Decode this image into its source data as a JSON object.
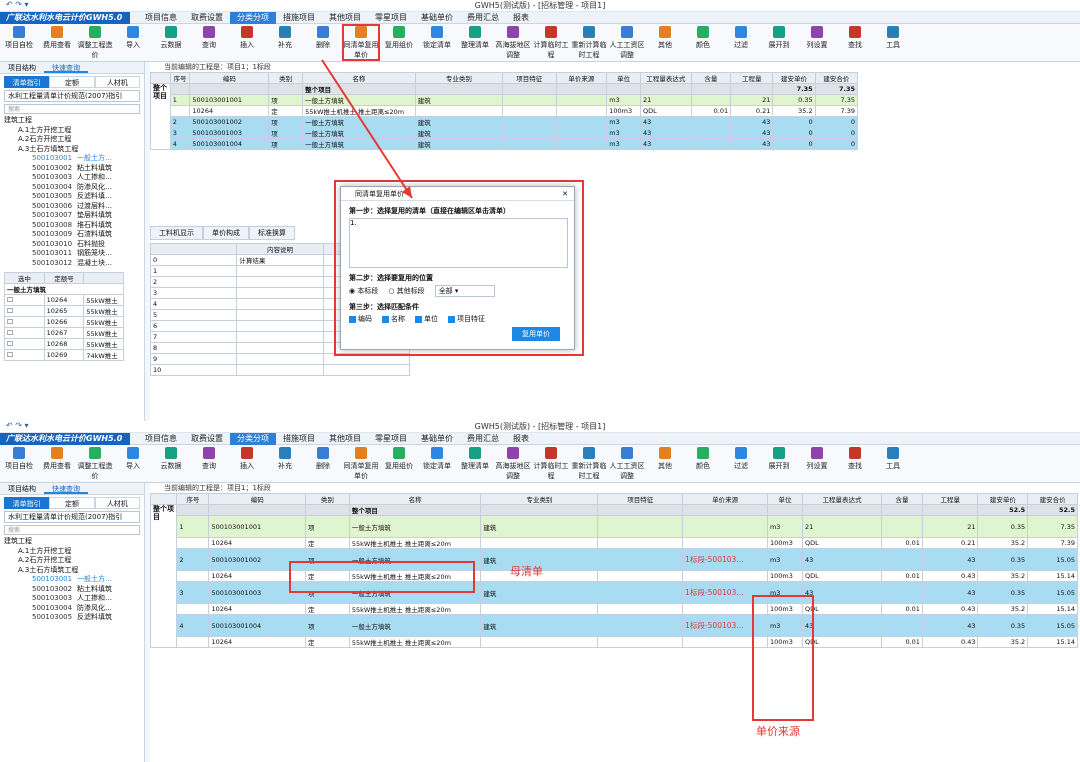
{
  "top": {
    "title": "GWH5(测试版) - [招标管理 - 项目1]",
    "brand": "广联达水利水电云计价GWH5.0",
    "menus": [
      "项目信息",
      "取费设置",
      "分类分项",
      "措施项目",
      "其他项目",
      "零星项目",
      "基础单价",
      "费用汇总",
      "报表"
    ],
    "active_menu": "分类分项",
    "ribbon": [
      "项目自检",
      "费用查看",
      "调整工程造价",
      "导入",
      "云数据",
      "查询",
      "插入",
      "补充",
      "删除",
      "同清单复用单价",
      "复用组价",
      "锁定清单",
      "整理清单",
      "高海拔地区调整",
      "计算临时工程",
      "重新计算临时工程",
      "人工工资区调整",
      "其他",
      "颜色",
      "过滤",
      "展开到",
      "列设置",
      "查找",
      "工具"
    ],
    "left_tabs": [
      "项目结构",
      "快速查询"
    ],
    "left_sub": [
      "清单指引",
      "定额",
      "人材机"
    ],
    "spec": "水利工程量清单计价规范(2007)指引",
    "search_placeholder": "搜索",
    "tree": [
      {
        "t": "建筑工程"
      },
      {
        "t": "A.1土方开挖工程"
      },
      {
        "t": "A.2石方开挖工程"
      },
      {
        "t": "A.3土石方填筑工程"
      },
      {
        "c": "500103001",
        "t": "一般土方…"
      },
      {
        "c": "500103002",
        "t": "粘土料填筑"
      },
      {
        "c": "500103003",
        "t": "人工掺和…"
      },
      {
        "c": "500103004",
        "t": "防渗风化…"
      },
      {
        "c": "500103005",
        "t": "反滤料填…"
      },
      {
        "c": "500103006",
        "t": "过渡层料…"
      },
      {
        "c": "500103007",
        "t": "垫层料填筑"
      },
      {
        "c": "500103008",
        "t": "堆石料填筑"
      },
      {
        "c": "500103009",
        "t": "石渣料填筑"
      },
      {
        "c": "500103010",
        "t": "石料抛投"
      },
      {
        "c": "500103011",
        "t": "钢筋笼块…"
      },
      {
        "c": "500103012",
        "t": "混凝土块…"
      }
    ],
    "sel_header": [
      "选中",
      "定额号"
    ],
    "sel_group": "一般土方填筑",
    "sel_rows": [
      [
        "10264",
        "55kW推土"
      ],
      [
        "10265",
        "55kW推土"
      ],
      [
        "10266",
        "55kW推土"
      ],
      [
        "10267",
        "55kW推土"
      ],
      [
        "10268",
        "55kW推土"
      ],
      [
        "10269",
        "74kW推土"
      ]
    ],
    "path": "当前编辑的工程是：项目1；1标段",
    "columns": [
      "序号",
      "编码",
      "类别",
      "名称",
      "专业类别",
      "项目特征",
      "单价来源",
      "单位",
      "工程量表达式",
      "含量",
      "工程量",
      "建安单价",
      "建安合价"
    ],
    "total_row": {
      "name": "整个项目",
      "price": "7.35",
      "sum": "7.35"
    },
    "side_label": "整个项目",
    "rows": [
      {
        "no": "1",
        "code": "500103001001",
        "kind": "项",
        "name": "一般土方填筑",
        "pro": "建筑",
        "unit": "m3",
        "expr": "21",
        "qty": "21",
        "price": "0.35",
        "sum": "7.35",
        "style": "green"
      },
      {
        "no": "",
        "code": "10264",
        "kind": "定",
        "name": "55kW推土机推土 推土距离≤20m",
        "pro": "",
        "unit": "100m3",
        "expr": "QDL",
        "rate": "0.01",
        "qty": "0.21",
        "price": "35.2",
        "sum": "7.39",
        "style": "white"
      },
      {
        "no": "2",
        "code": "500103001002",
        "kind": "项",
        "name": "一般土方填筑",
        "pro": "建筑",
        "unit": "m3",
        "expr": "43",
        "qty": "43",
        "price": "0",
        "sum": "0",
        "style": "blue"
      },
      {
        "no": "3",
        "code": "500103001003",
        "kind": "项",
        "name": "一般土方填筑",
        "pro": "建筑",
        "unit": "m3",
        "expr": "43",
        "qty": "43",
        "price": "0",
        "sum": "0",
        "style": "blue"
      },
      {
        "no": "4",
        "code": "500103001004",
        "kind": "项",
        "name": "一般土方填筑",
        "pro": "建筑",
        "unit": "m3",
        "expr": "43",
        "qty": "43",
        "price": "0",
        "sum": "0",
        "style": "blue"
      }
    ],
    "bottom_tabs": [
      "工料机显示",
      "单价构成",
      "标准换算"
    ],
    "detail_head": "内容说明",
    "detail_first": "计算结果",
    "detail_rows": [
      "1",
      "2",
      "3",
      "4",
      "5",
      "6",
      "7",
      "8",
      "9",
      "10"
    ],
    "dialog": {
      "title": "同清单复用单价",
      "step1": "第一步：选择复用的清单（直接在编辑区单击清单）",
      "text": "1.",
      "step2": "第二步：选择要复用的位置",
      "opt1": "本标段",
      "opt2": "其他标段",
      "scope": "全部",
      "step3": "第三步：选择匹配条件",
      "conds": [
        "编码",
        "名称",
        "单位",
        "项目特征"
      ],
      "btn": "复用单价"
    }
  },
  "bottom": {
    "title": "GWH5(测试版) - [招标管理 - 项目1]",
    "brand": "广联达水利水电云计价GWH5.0",
    "menus": [
      "项目信息",
      "取费设置",
      "分类分项",
      "措施项目",
      "其他项目",
      "零星项目",
      "基础单价",
      "费用汇总",
      "报表"
    ],
    "ribbon": [
      "项目自检",
      "费用查看",
      "调整工程造价",
      "导入",
      "云数据",
      "查询",
      "插入",
      "补充",
      "删除",
      "同清单复用单价",
      "复用组价",
      "锁定清单",
      "整理清单",
      "高海拔地区调整",
      "计算临时工程",
      "重新计算临时工程",
      "人工工资区调整",
      "其他",
      "颜色",
      "过滤",
      "展开到",
      "列设置",
      "查找",
      "工具"
    ],
    "left_tabs": [
      "项目结构",
      "快速查询"
    ],
    "left_sub": [
      "清单指引",
      "定额",
      "人材机"
    ],
    "spec": "水利工程量清单计价规范(2007)指引",
    "search_placeholder": "搜索",
    "tree": [
      {
        "t": "建筑工程"
      },
      {
        "t": "A.1土方开挖工程"
      },
      {
        "t": "A.2石方开挖工程"
      },
      {
        "t": "A.3土石方填筑工程"
      },
      {
        "c": "500103001",
        "t": "一般土方…"
      },
      {
        "c": "500103002",
        "t": "粘土料填筑"
      },
      {
        "c": "500103003",
        "t": "人工掺和…"
      },
      {
        "c": "500103004",
        "t": "防渗风化…"
      },
      {
        "c": "500103005",
        "t": "反滤料填筑"
      }
    ],
    "path": "当前编辑的工程是：项目1；1标段",
    "columns": [
      "序号",
      "编码",
      "类别",
      "名称",
      "专业类别",
      "项目特征",
      "单价来源",
      "单位",
      "工程量表达式",
      "含量",
      "工程量",
      "建安单价",
      "建安合价"
    ],
    "total_row": {
      "name": "整个项目",
      "price": "52.5",
      "sum": "52.5"
    },
    "side_label": "整个项目",
    "rows": [
      {
        "no": "1",
        "code": "500103001001",
        "kind": "项",
        "name": "一般土方填筑",
        "pro": "建筑",
        "src": "",
        "unit": "m3",
        "expr": "21",
        "qty": "21",
        "price": "0.35",
        "sum": "7.35",
        "style": "green"
      },
      {
        "no": "",
        "code": "10264",
        "kind": "定",
        "name": "55kW推土机推土 推土距离≤20m",
        "pro": "",
        "src": "",
        "unit": "100m3",
        "expr": "QDL",
        "rate": "0.01",
        "qty": "0.21",
        "price": "35.2",
        "sum": "7.39",
        "style": "white"
      },
      {
        "no": "2",
        "code": "500103001002",
        "kind": "项",
        "name": "一般土方填筑",
        "pro": "建筑",
        "src": "1标段-500103…",
        "unit": "m3",
        "expr": "43",
        "qty": "43",
        "price": "0.35",
        "sum": "15.05",
        "style": "blue"
      },
      {
        "no": "",
        "code": "10264",
        "kind": "定",
        "name": "55kW推土机推土 推土距离≤20m",
        "pro": "",
        "src": "",
        "unit": "100m3",
        "expr": "QDL",
        "rate": "0.01",
        "qty": "0.43",
        "price": "35.2",
        "sum": "15.14",
        "style": "white"
      },
      {
        "no": "3",
        "code": "500103001003",
        "kind": "项",
        "name": "一般土方填筑",
        "pro": "建筑",
        "src": "1标段-500103…",
        "unit": "m3",
        "expr": "43",
        "qty": "43",
        "price": "0.35",
        "sum": "15.05",
        "style": "blue"
      },
      {
        "no": "",
        "code": "10264",
        "kind": "定",
        "name": "55kW推土机推土 推土距离≤20m",
        "pro": "",
        "src": "",
        "unit": "100m3",
        "expr": "QDL",
        "rate": "0.01",
        "qty": "0.43",
        "price": "35.2",
        "sum": "15.14",
        "style": "white"
      },
      {
        "no": "4",
        "code": "500103001004",
        "kind": "项",
        "name": "一般土方填筑",
        "pro": "建筑",
        "src": "1标段-500103…",
        "unit": "m3",
        "expr": "43",
        "qty": "43",
        "price": "0.35",
        "sum": "15.05",
        "style": "blue"
      },
      {
        "no": "",
        "code": "10264",
        "kind": "定",
        "name": "55kW推土机推土 推土距离≤20m",
        "pro": "",
        "src": "",
        "unit": "100m3",
        "expr": "QDL",
        "rate": "0.01",
        "qty": "0.43",
        "price": "35.2",
        "sum": "15.14",
        "style": "white"
      }
    ],
    "anno_mother": "母清单",
    "anno_source": "单价来源"
  },
  "colors": {
    "accent": "#1e88e5",
    "highlight": "#e53935",
    "green_row": "#dff4cf",
    "blue_row": "#a8dcf2"
  }
}
